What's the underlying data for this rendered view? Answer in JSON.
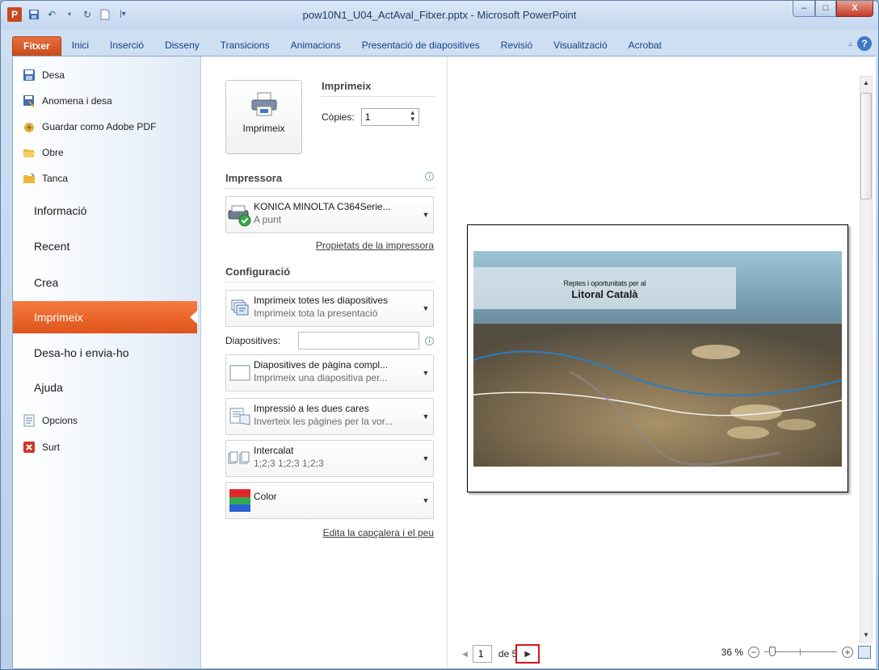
{
  "window": {
    "title": "pow10N1_U04_ActAval_Fitxer.pptx - Microsoft PowerPoint",
    "app_badge": "P",
    "buttons": {
      "minimize": "–",
      "maximize": "□",
      "close": "X"
    }
  },
  "ribbon": {
    "tabs": [
      "Fitxer",
      "Inici",
      "Inserció",
      "Disseny",
      "Transicions",
      "Animacions",
      "Presentació de diapositives",
      "Revisió",
      "Visualització",
      "Acrobat"
    ],
    "help": "?"
  },
  "backstage_nav": {
    "commands_top": [
      {
        "label": "Desa",
        "icon": "save-icon"
      },
      {
        "label": "Anomena i desa",
        "icon": "save-as-icon"
      },
      {
        "label": "Guardar como Adobe PDF",
        "icon": "pdf-icon"
      },
      {
        "label": "Obre",
        "icon": "open-folder-icon"
      },
      {
        "label": "Tanca",
        "icon": "close-folder-icon"
      }
    ],
    "tabs": [
      "Informació",
      "Recent",
      "Crea",
      "Imprimeix",
      "Desa-ho i envia-ho",
      "Ajuda"
    ],
    "active_tab": "Imprimeix",
    "commands_bottom": [
      {
        "label": "Opcions",
        "icon": "options-icon"
      },
      {
        "label": "Surt",
        "icon": "exit-icon"
      }
    ]
  },
  "print": {
    "button_label": "Imprimeix",
    "header": "Imprimeix",
    "copies_label": "Còpies:",
    "copies_value": "1",
    "printer_section": "Impressora",
    "printer_name": "KONICA MINOLTA C364Serie...",
    "printer_status": "A punt",
    "printer_props_link": "Propietats de la impressora",
    "config_section": "Configuració",
    "range_main": "Imprimeix totes les diapositives",
    "range_sub": "Imprimeix tota la presentació",
    "slides_label": "Diapositives:",
    "slides_value": "",
    "layout_main": "Diapositives de pàgina compl...",
    "layout_sub": "Imprimeix una diapositiva per...",
    "duplex_main": "Impressió a les dues cares",
    "duplex_sub": "Inverteix les pàgines per la vor...",
    "collate_main": "Intercalat",
    "collate_sub": "1;2;3   1;2;3   1;2;3",
    "color_main": "Color",
    "header_footer_link": "Edita la capçalera i el peu"
  },
  "preview": {
    "slide_subtitle": "Reptes i oportunitats per al",
    "slide_title": "Litoral Català",
    "page_current": "1",
    "page_of": "de 5",
    "zoom_percent": "36 %"
  },
  "colors": {
    "file_tab": "#d65a24",
    "active_nav": "#ec6a2c",
    "highlight_box": "#d9141b"
  }
}
